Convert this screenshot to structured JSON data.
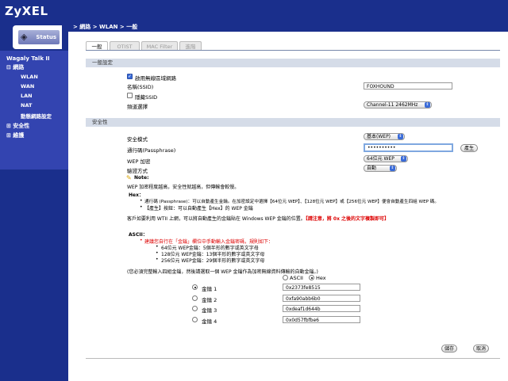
{
  "brand": "ZyXEL",
  "breadcrumb": "> 網路 > WLAN > 一般",
  "sidebar": {
    "status_label": "Status",
    "device": "Wagaly Talk II",
    "sections": [
      {
        "label": "⊟ 網路"
      },
      {
        "label": "⊞ 安全性"
      },
      {
        "label": "⊞ 維護"
      }
    ],
    "items": [
      "WLAN",
      "WAN",
      "LAN",
      "NAT",
      "動態網路設定"
    ]
  },
  "tabs": [
    "一般",
    "OTIST",
    "MAC Filter",
    "進階"
  ],
  "general": {
    "header": "一般設定",
    "enable_wlan_label": "啟用無線區域網路",
    "ssid_label": "名稱(SSID)",
    "ssid_value": "FOXHOUND",
    "hide_ssid_label": "隱藏SSID",
    "channel_label": "頻道選擇",
    "channel_value": "Channel-11 2462MHz"
  },
  "security": {
    "header": "安全性",
    "mode_label": "安全模式",
    "mode_value": "基本(WEP)",
    "passphrase_label": "通行碼(Passphrase)",
    "passphrase_value": "••••••••••",
    "generate_button": "產生",
    "wep_enc_label": "WEP 加密",
    "wep_enc_value": "64位元 WEP",
    "auth_label": "驗證方式",
    "auth_value": "自動",
    "note_title": "Note:",
    "note_line1": "WEP 加密程度越高，安全性就越高，但傳輸會較慢。",
    "hex_title": "Hex：",
    "hex_bullet1": "通行碼 (Passphrase)：可以自動產生金鑰。在加密設定中選擇【64位元 WEP】、【128位元 WEP】或【256位元 WEP】便會自動產生四組 WEP 碼。",
    "hex_bullet2": "【產生】按鈕：可以自動產生【Hex】的 WEP 金鑰",
    "wtii_line_a": "客戶如要利用 WTII 上網，可以將自動產生的金鑰貼在 Windows WEP 金鑰的位置。",
    "wtii_line_b": "【請注意，將 0x 之後的文字複製即可】",
    "ascii_title": "ASCII：",
    "ascii_warn": "建議您自行在「金鑰」欄位中手動輸入金鑰密碼，規則如下：",
    "ascii_rules": [
      "64位元 WEP金鑰：5個半形的數字或英文字母",
      "128位元 WEP金鑰：13個半形的數字或英文字母",
      "256位元 WEP金鑰：29個半形的數字或英文字母"
    ],
    "keys_intro": "(您必須完整輸入四組金鑰，然後請選取一個 WEP 金鑰作為加密無線資料傳輸的自動金鑰。)",
    "format_ascii": "ASCII",
    "format_hex": "Hex",
    "keys": [
      {
        "label": "金鑰 1",
        "value": "0x2373fe8515"
      },
      {
        "label": "金鑰 2",
        "value": "0xfa90abb6b0"
      },
      {
        "label": "金鑰 3",
        "value": "0xdeaf1d644b"
      },
      {
        "label": "金鑰 4",
        "value": "0x0d57fbfbe6"
      }
    ]
  },
  "actions": {
    "save": "儲存",
    "cancel": "取消"
  }
}
